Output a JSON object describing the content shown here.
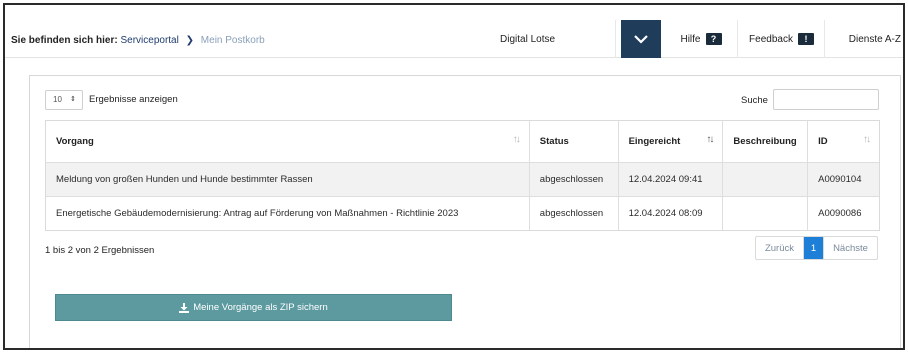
{
  "breadcrumb": {
    "label": "Sie befinden sich hier:",
    "items": [
      "Serviceportal",
      "Mein Postkorb"
    ],
    "separator": "❯"
  },
  "nav": {
    "lotse": "Digital Lotse",
    "hilfe": "Hilfe",
    "hilfe_icon": "?",
    "feedback": "Feedback",
    "feedback_icon": "!",
    "dienste": "Dienste A-Z"
  },
  "table_controls": {
    "length_value": "10",
    "length_label": "Ergebnisse anzeigen",
    "search_label": "Suche",
    "search_value": ""
  },
  "table": {
    "columns": [
      "Vorgang",
      "Status",
      "Eingereicht",
      "Beschreibung",
      "ID"
    ],
    "rows": [
      {
        "vorgang": "Meldung von großen Hunden und Hunde bestimmter Rassen",
        "status": "abgeschlossen",
        "eingereicht": "12.04.2024 09:41",
        "beschreibung": "",
        "id": "A0090104"
      },
      {
        "vorgang": "Energetische Gebäudemodernisierung: Antrag auf Förderung von Maßnahmen - Richtlinie 2023",
        "status": "abgeschlossen",
        "eingereicht": "12.04.2024 08:09",
        "beschreibung": "",
        "id": "A0090086"
      }
    ]
  },
  "info": "1 bis 2 von 2 Ergebnissen",
  "pager": {
    "prev": "Zurück",
    "current": "1",
    "next": "Nächste"
  },
  "zip_button": "Meine Vorgänge als ZIP sichern",
  "colors": {
    "nav_dark": "#1f3c5a",
    "button_teal": "#5c9aa0",
    "pager_active": "#1e7fd6",
    "row_stripe": "#f2f2f2"
  }
}
